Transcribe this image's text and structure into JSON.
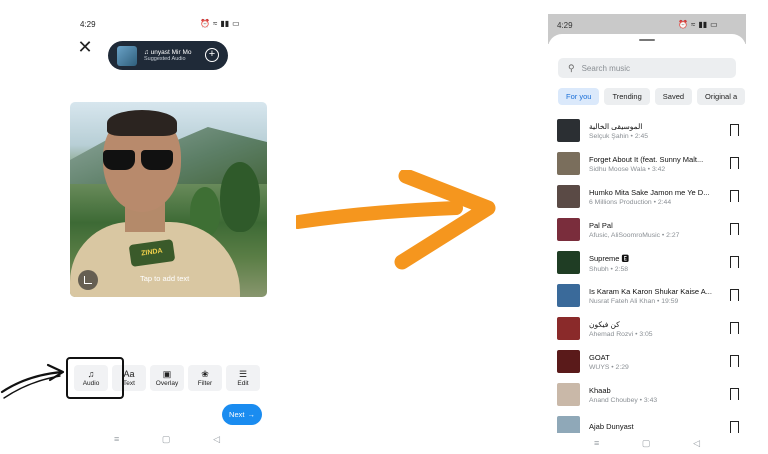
{
  "left_phone": {
    "status_time": "4:29",
    "status_icons": [
      "alarm-icon",
      "wifi-icon",
      "signal-icon",
      "battery-icon"
    ],
    "audio_pill": {
      "title": "♫ ​unyast   Mir Mo",
      "subtitle": "Suggested Audio"
    },
    "photo_overlay_text": "Tap to add text",
    "shirt_print": "ZINDA",
    "tools": [
      {
        "label": "Audio",
        "icon": "music-note-icon",
        "glyph": "♫"
      },
      {
        "label": "Text",
        "icon": "text-icon",
        "glyph": "Aa"
      },
      {
        "label": "Overlay",
        "icon": "overlay-icon",
        "glyph": "▣"
      },
      {
        "label": "Filter",
        "icon": "filter-icon",
        "glyph": "❀"
      },
      {
        "label": "Edit",
        "icon": "edit-sliders-icon",
        "glyph": "☰"
      }
    ],
    "next_label": "Next",
    "nav": [
      "≡",
      "▢",
      "◁"
    ]
  },
  "right_phone": {
    "status_time": "4:29",
    "search_placeholder": "Search music",
    "tabs": [
      "For you",
      "Trending",
      "Saved",
      "Original a"
    ],
    "active_tab": "For you",
    "songs": [
      {
        "title": "الموسيقى الخالية",
        "subtitle": "Selçuk Şahin • 2:45",
        "color": "#2b2f33"
      },
      {
        "title": "Forget About It (feat. Sunny Malt...",
        "subtitle": "Sidhu Moose Wala • 3:42",
        "color": "#7a6e5c"
      },
      {
        "title": "Humko Mita Sake Jamon me Ye D...",
        "subtitle": "6 Millions Production • 2:44",
        "color": "#5a4a45"
      },
      {
        "title": "Pal Pal",
        "subtitle": "Afusic, AliSoomroMusic • 2:27",
        "color": "#7a2d3c"
      },
      {
        "title": "Supreme 🅴",
        "subtitle": "Shubh • 2:58",
        "color": "#1f3d24"
      },
      {
        "title": "Is Karam Ka Karon Shukar Kaise A...",
        "subtitle": "Nusrat Fateh Ali Khan • 19:59",
        "color": "#3a6a9a"
      },
      {
        "title": "كن فيكون",
        "subtitle": "Ahemad Rozvi • 3:05",
        "color": "#8a2a2a"
      },
      {
        "title": "GOAT",
        "subtitle": "WUYS • 2:29",
        "color": "#5a1a1a"
      },
      {
        "title": "Khaab",
        "subtitle": "Anand Choubey • 3:43",
        "color": "#c9b8a8"
      },
      {
        "title": "Ajab Dunyast",
        "subtitle": "",
        "color": "#8fa8b8"
      }
    ],
    "nav": [
      "≡",
      "▢",
      "◁"
    ]
  },
  "annotation": {
    "arrow_color": "#f5961e"
  }
}
